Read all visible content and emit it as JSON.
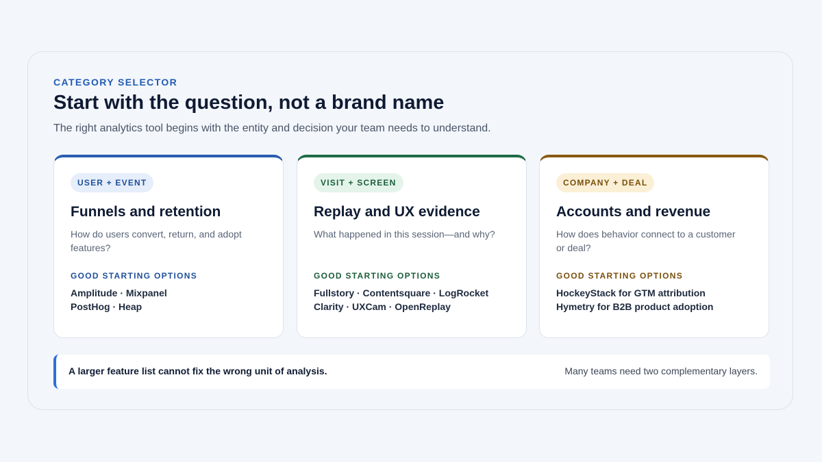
{
  "header": {
    "eyebrow": "CATEGORY SELECTOR",
    "title": "Start with the question, not a brand name",
    "subtitle": "The right analytics tool begins with the entity and decision your team needs to understand."
  },
  "cards": [
    {
      "tag": "USER + EVENT",
      "title": "Funnels and retention",
      "question": "How do users convert, return, and adopt features?",
      "options_label": "GOOD STARTING OPTIONS",
      "options": [
        "Amplitude · Mixpanel",
        "PostHog · Heap"
      ],
      "accent": "#2a5db0"
    },
    {
      "tag": "VISIT + SCREEN",
      "title": "Replay and UX evidence",
      "question": "What happened in this session—and why?",
      "options_label": "GOOD STARTING OPTIONS",
      "options": [
        "Fullstory · Contentsquare · LogRocket",
        "Clarity · UXCam · OpenReplay"
      ],
      "accent": "#1d6b45"
    },
    {
      "tag": "COMPANY + DEAL",
      "title": "Accounts and revenue",
      "question": "How does behavior connect to a customer or deal?",
      "options_label": "GOOD STARTING OPTIONS",
      "options": [
        "HockeyStack for GTM attribution",
        "Hymetry for B2B product adoption"
      ],
      "accent": "#8a5a12"
    }
  ],
  "note": {
    "left": "A larger feature list cannot fix the wrong unit of analysis.",
    "right": "Many teams need two complementary layers."
  }
}
